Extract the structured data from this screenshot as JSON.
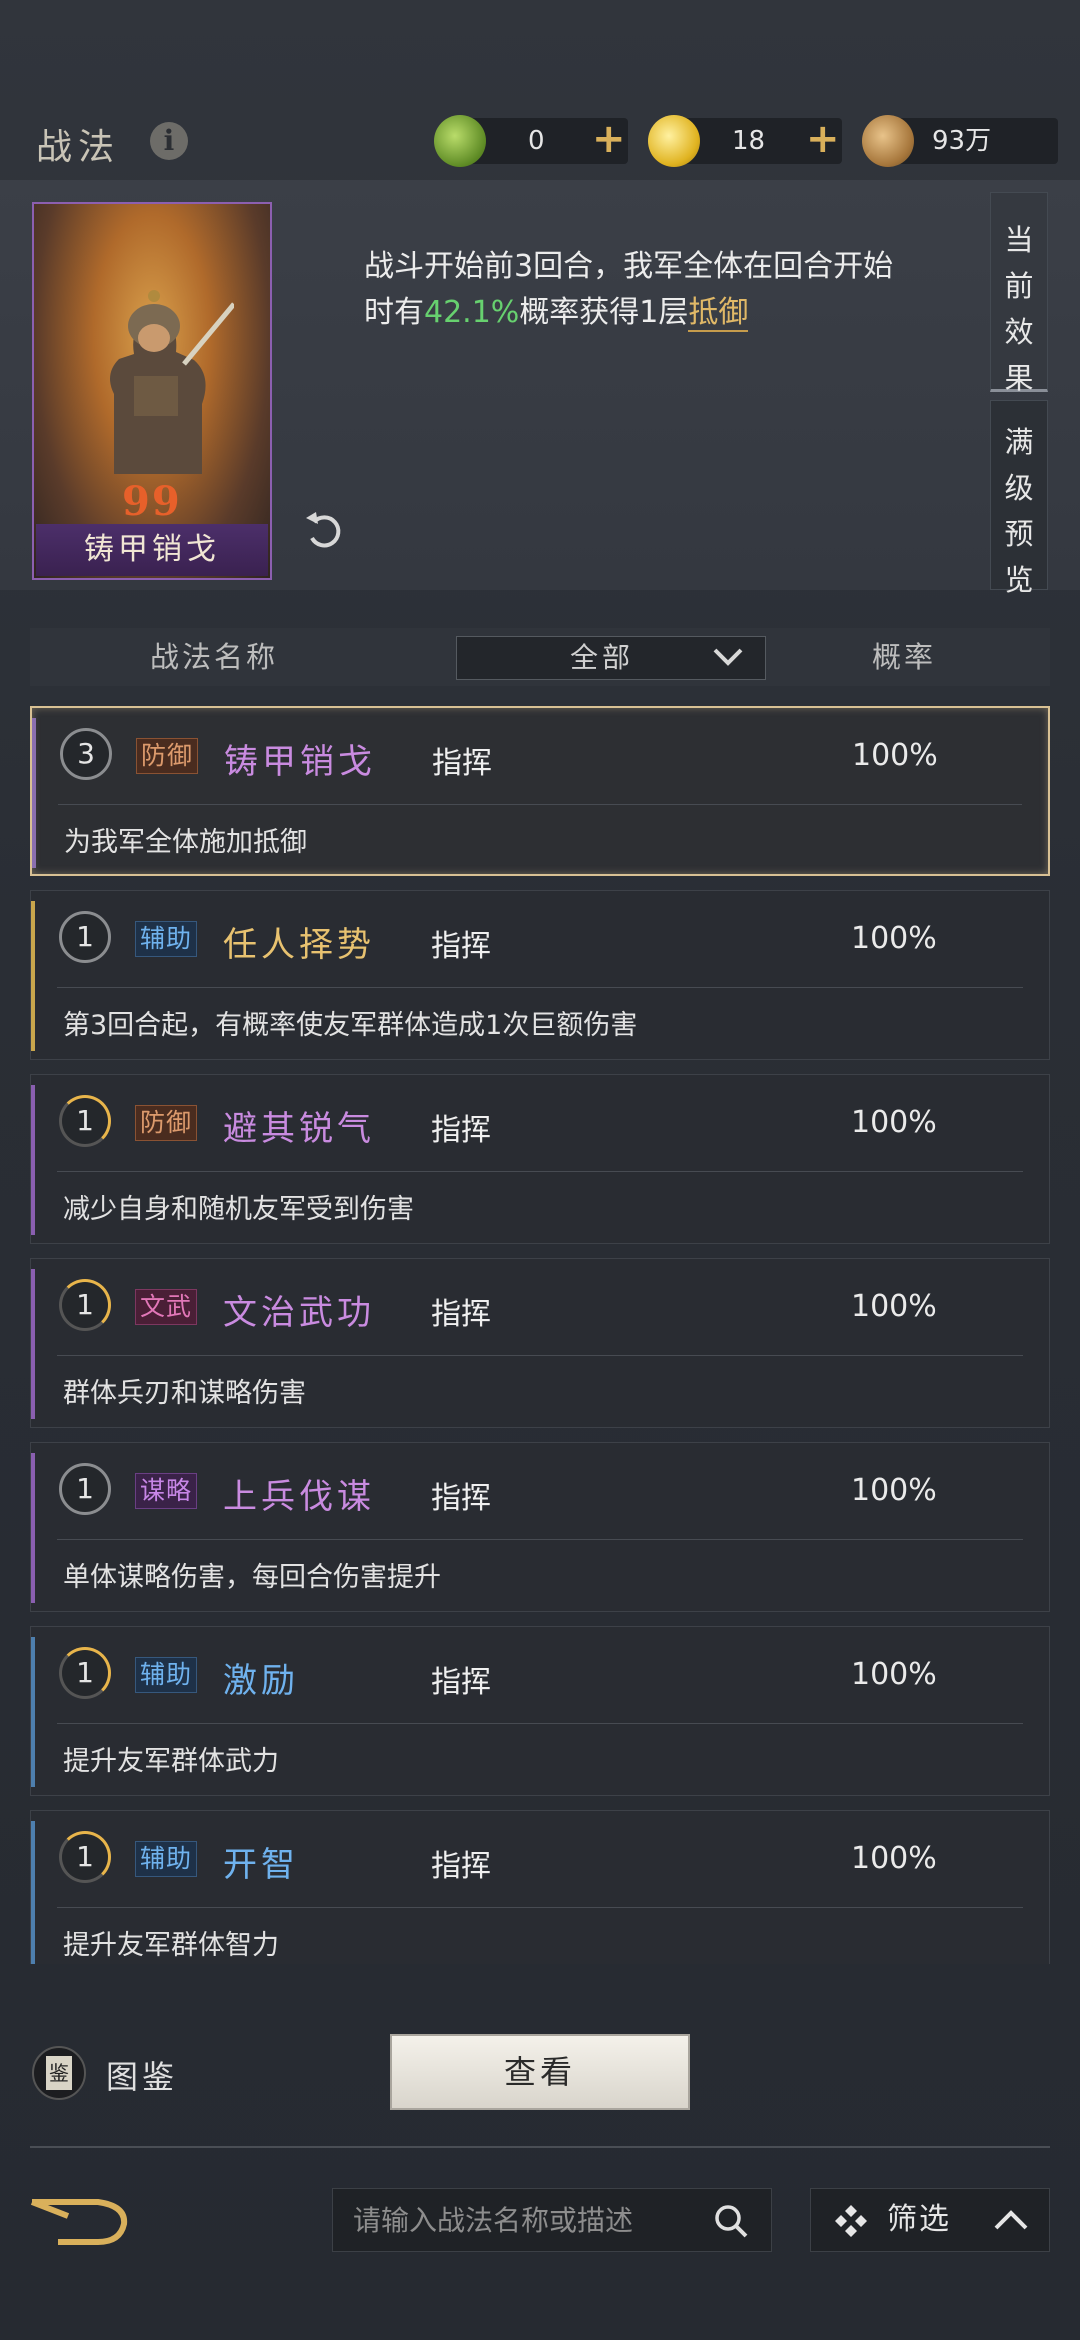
{
  "header": {
    "title": "战法",
    "info_icon": "i",
    "resources": [
      {
        "name": "jade-coin",
        "value": "0",
        "plus": "+",
        "color": "#7fae3a"
      },
      {
        "name": "gold-coin",
        "value": "18",
        "plus": "+",
        "color": "#e3b928"
      },
      {
        "name": "copper-coin",
        "value": "93万",
        "color": "#b88a4a"
      }
    ]
  },
  "card": {
    "name": "铸甲销戈",
    "marks": "99"
  },
  "effect": {
    "line1": "战斗开始前3回合，我军全体在回合开始",
    "line2_prefix": "时有",
    "line2_rate": "42.1%",
    "line2_mid": "概率获得1层",
    "line2_keyword": "抵御"
  },
  "side_tabs": {
    "current": "当前效果",
    "max": "满级预览"
  },
  "list_header": {
    "col_name": "战法名称",
    "filter": "全部",
    "col_rate": "概率"
  },
  "skills": [
    {
      "level": "3",
      "tag": "防御",
      "tag_type": "def",
      "name": "铸甲销戈",
      "name_color": "#c98be0",
      "type": "指挥",
      "rate": "100%",
      "desc": "为我军全体施加抵御",
      "edge": "#8a6fb0",
      "selected": true,
      "ring": "gray"
    },
    {
      "level": "1",
      "tag": "辅助",
      "tag_type": "aid",
      "name": "任人择势",
      "name_color": "#e8c270",
      "type": "指挥",
      "rate": "100%",
      "desc": "第3回合起，有概率使友军群体造成1次巨额伤害",
      "edge": "#c9a64c",
      "selected": false,
      "ring": "gray"
    },
    {
      "level": "1",
      "tag": "防御",
      "tag_type": "def",
      "name": "避其锐气",
      "name_color": "#c98be0",
      "type": "指挥",
      "rate": "100%",
      "desc": "减少自身和随机友军受到伤害",
      "edge": "#8a5fb0",
      "selected": false,
      "ring": "gold"
    },
    {
      "level": "1",
      "tag": "文武",
      "tag_type": "lit",
      "name": "文治武功",
      "name_color": "#c98be0",
      "type": "指挥",
      "rate": "100%",
      "desc": "群体兵刃和谋略伤害",
      "edge": "#8a5fb0",
      "selected": false,
      "ring": "gold"
    },
    {
      "level": "1",
      "tag": "谋略",
      "tag_type": "tac",
      "name": "上兵伐谋",
      "name_color": "#c98be0",
      "type": "指挥",
      "rate": "100%",
      "desc": "单体谋略伤害，每回合伤害提升",
      "edge": "#8a5fb0",
      "selected": false,
      "ring": "gray"
    },
    {
      "level": "1",
      "tag": "辅助",
      "tag_type": "aid",
      "name": "激励",
      "name_color": "#6fb2ee",
      "type": "指挥",
      "rate": "100%",
      "desc": "提升友军群体武力",
      "edge": "#4e7fae",
      "selected": false,
      "ring": "gold"
    },
    {
      "level": "1",
      "tag": "辅助",
      "tag_type": "aid",
      "name": "开智",
      "name_color": "#6fb2ee",
      "type": "指挥",
      "rate": "100%",
      "desc": "提升友军群体智力",
      "edge": "#4e7fae",
      "selected": false,
      "ring": "gold"
    }
  ],
  "bottom": {
    "codex_label": "图鉴",
    "codex_icon_char": "鉴",
    "view_button": "查看",
    "search_placeholder": "请输入战法名称或描述",
    "filter_label": "筛选"
  }
}
